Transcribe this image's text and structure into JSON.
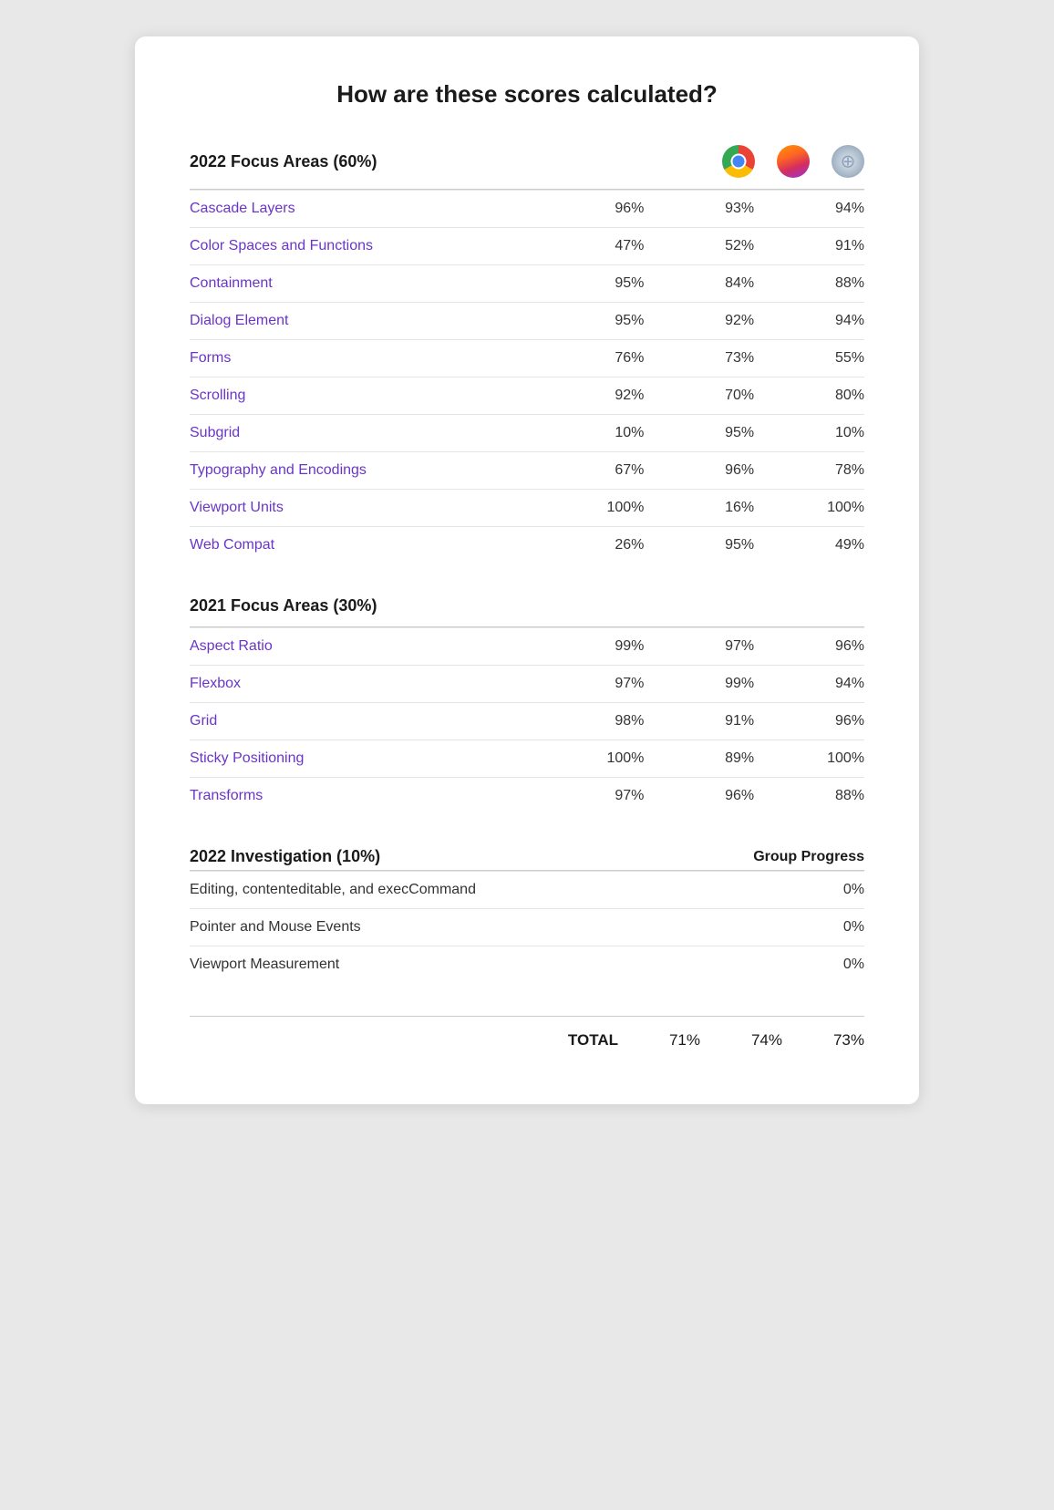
{
  "page": {
    "title": "How are these scores calculated?",
    "card_bg": "#ffffff"
  },
  "sections": {
    "focus2022": {
      "title": "2022 Focus Areas (60%)",
      "rows": [
        {
          "label": "Cascade Layers",
          "link": true,
          "col1": "96%",
          "col2": "93%",
          "col3": "94%"
        },
        {
          "label": "Color Spaces and Functions",
          "link": true,
          "col1": "47%",
          "col2": "52%",
          "col3": "91%"
        },
        {
          "label": "Containment",
          "link": true,
          "col1": "95%",
          "col2": "84%",
          "col3": "88%"
        },
        {
          "label": "Dialog Element",
          "link": true,
          "col1": "95%",
          "col2": "92%",
          "col3": "94%"
        },
        {
          "label": "Forms",
          "link": true,
          "col1": "76%",
          "col2": "73%",
          "col3": "55%"
        },
        {
          "label": "Scrolling",
          "link": true,
          "col1": "92%",
          "col2": "70%",
          "col3": "80%"
        },
        {
          "label": "Subgrid",
          "link": true,
          "col1": "10%",
          "col2": "95%",
          "col3": "10%"
        },
        {
          "label": "Typography and Encodings",
          "link": true,
          "col1": "67%",
          "col2": "96%",
          "col3": "78%"
        },
        {
          "label": "Viewport Units",
          "link": true,
          "col1": "100%",
          "col2": "16%",
          "col3": "100%"
        },
        {
          "label": "Web Compat",
          "link": true,
          "col1": "26%",
          "col2": "95%",
          "col3": "49%"
        }
      ]
    },
    "focus2021": {
      "title": "2021 Focus Areas (30%)",
      "rows": [
        {
          "label": "Aspect Ratio",
          "link": true,
          "col1": "99%",
          "col2": "97%",
          "col3": "96%"
        },
        {
          "label": "Flexbox",
          "link": true,
          "col1": "97%",
          "col2": "99%",
          "col3": "94%"
        },
        {
          "label": "Grid",
          "link": true,
          "col1": "98%",
          "col2": "91%",
          "col3": "96%"
        },
        {
          "label": "Sticky Positioning",
          "link": true,
          "col1": "100%",
          "col2": "89%",
          "col3": "100%"
        },
        {
          "label": "Transforms",
          "link": true,
          "col1": "97%",
          "col2": "96%",
          "col3": "88%"
        }
      ]
    },
    "investigation2022": {
      "title": "2022 Investigation (10%)",
      "group_progress_label": "Group Progress",
      "rows": [
        {
          "label": "Editing, contenteditable, and execCommand",
          "link": false,
          "col3": "0%"
        },
        {
          "label": "Pointer and Mouse Events",
          "link": false,
          "col3": "0%"
        },
        {
          "label": "Viewport Measurement",
          "link": false,
          "col3": "0%"
        }
      ]
    }
  },
  "total": {
    "label": "TOTAL",
    "col1": "71%",
    "col2": "74%",
    "col3": "73%"
  }
}
